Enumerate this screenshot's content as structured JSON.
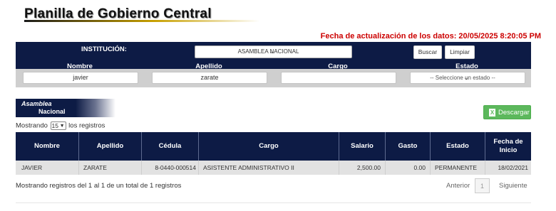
{
  "header": {
    "title": "Planilla de Gobierno Central",
    "update_text": "Fecha de actualización de los datos: 20/05/2025 8:20:05 PM"
  },
  "search": {
    "institucion_label": "INSTITUCIÓN:",
    "institucion_value": "ASAMBLEA NACIONAL",
    "buscar_label": "Buscar",
    "limpiar_label": "Limpiar",
    "nombre_label": "Nombre",
    "apellido_label": "Apellido",
    "cargo_label": "Cargo",
    "estado_label": "Estado",
    "nombre_value": "javier",
    "apellido_value": "zarate",
    "cargo_value": "",
    "estado_value": "-- Seleccione un estado --"
  },
  "tab": {
    "line1": "Asamblea",
    "line2": "Nacional"
  },
  "download": {
    "label": "Descargar",
    "icon": "excel-file-icon"
  },
  "length_menu": {
    "prefix": "Mostrando",
    "value": "15",
    "suffix": "los registros"
  },
  "table": {
    "columns": [
      "Nombre",
      "Apellido",
      "Cédula",
      "Cargo",
      "Salario",
      "Gasto",
      "Estado",
      "Fecha de Inicio"
    ],
    "rows": [
      {
        "nombre": "JAVIER",
        "apellido": "ZARATE",
        "cedula": "8-0440-000514",
        "cargo": "ASISTENTE ADMINISTRATIVO II",
        "salario": "2,500.00",
        "gasto": "0.00",
        "estado": "PERMANENTE",
        "fecha": "18/02/2021"
      }
    ]
  },
  "footer": {
    "info": "Mostrando registros del 1 al 1 de un total de 1 registros",
    "prev": "Anterior",
    "page": "1",
    "next": "Siguiente"
  },
  "colors": {
    "navy": "#0d1b45",
    "update_red": "#cc0000",
    "download_green": "#5cb85c"
  }
}
